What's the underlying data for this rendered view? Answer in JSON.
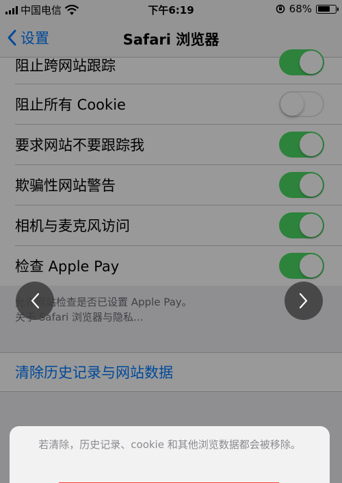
{
  "status_bar": {
    "carrier": "中国电信",
    "time": "下午6:19",
    "battery_percent": "68%",
    "battery_level": 0.68
  },
  "nav": {
    "back_label": "设置",
    "title": "Safari 浏览器"
  },
  "settings": [
    {
      "label": "阻止跨网站跟踪",
      "toggle": "on"
    },
    {
      "label": "阻止所有 Cookie",
      "toggle": "off"
    },
    {
      "label": "要求网站不要跟踪我",
      "toggle": "on"
    },
    {
      "label": "欺骗性网站警告",
      "toggle": "on"
    },
    {
      "label": "相机与麦克风访问",
      "toggle": "on"
    },
    {
      "label": "检查 Apple Pay",
      "toggle": "on"
    }
  ],
  "footer": {
    "line1": "允许网站检查是否已设置 Apple Pay。",
    "line2": "关于 Safari 浏览器与隐私..."
  },
  "clear_history_label": "清除历史记录与网站数据",
  "sheet": {
    "message": "若清除，历史记录、cookie 和其他浏览数据都会被移除。"
  },
  "colors": {
    "accent": "#007aff",
    "toggle_on": "#4cd964",
    "destructive": "#ff3b30"
  }
}
